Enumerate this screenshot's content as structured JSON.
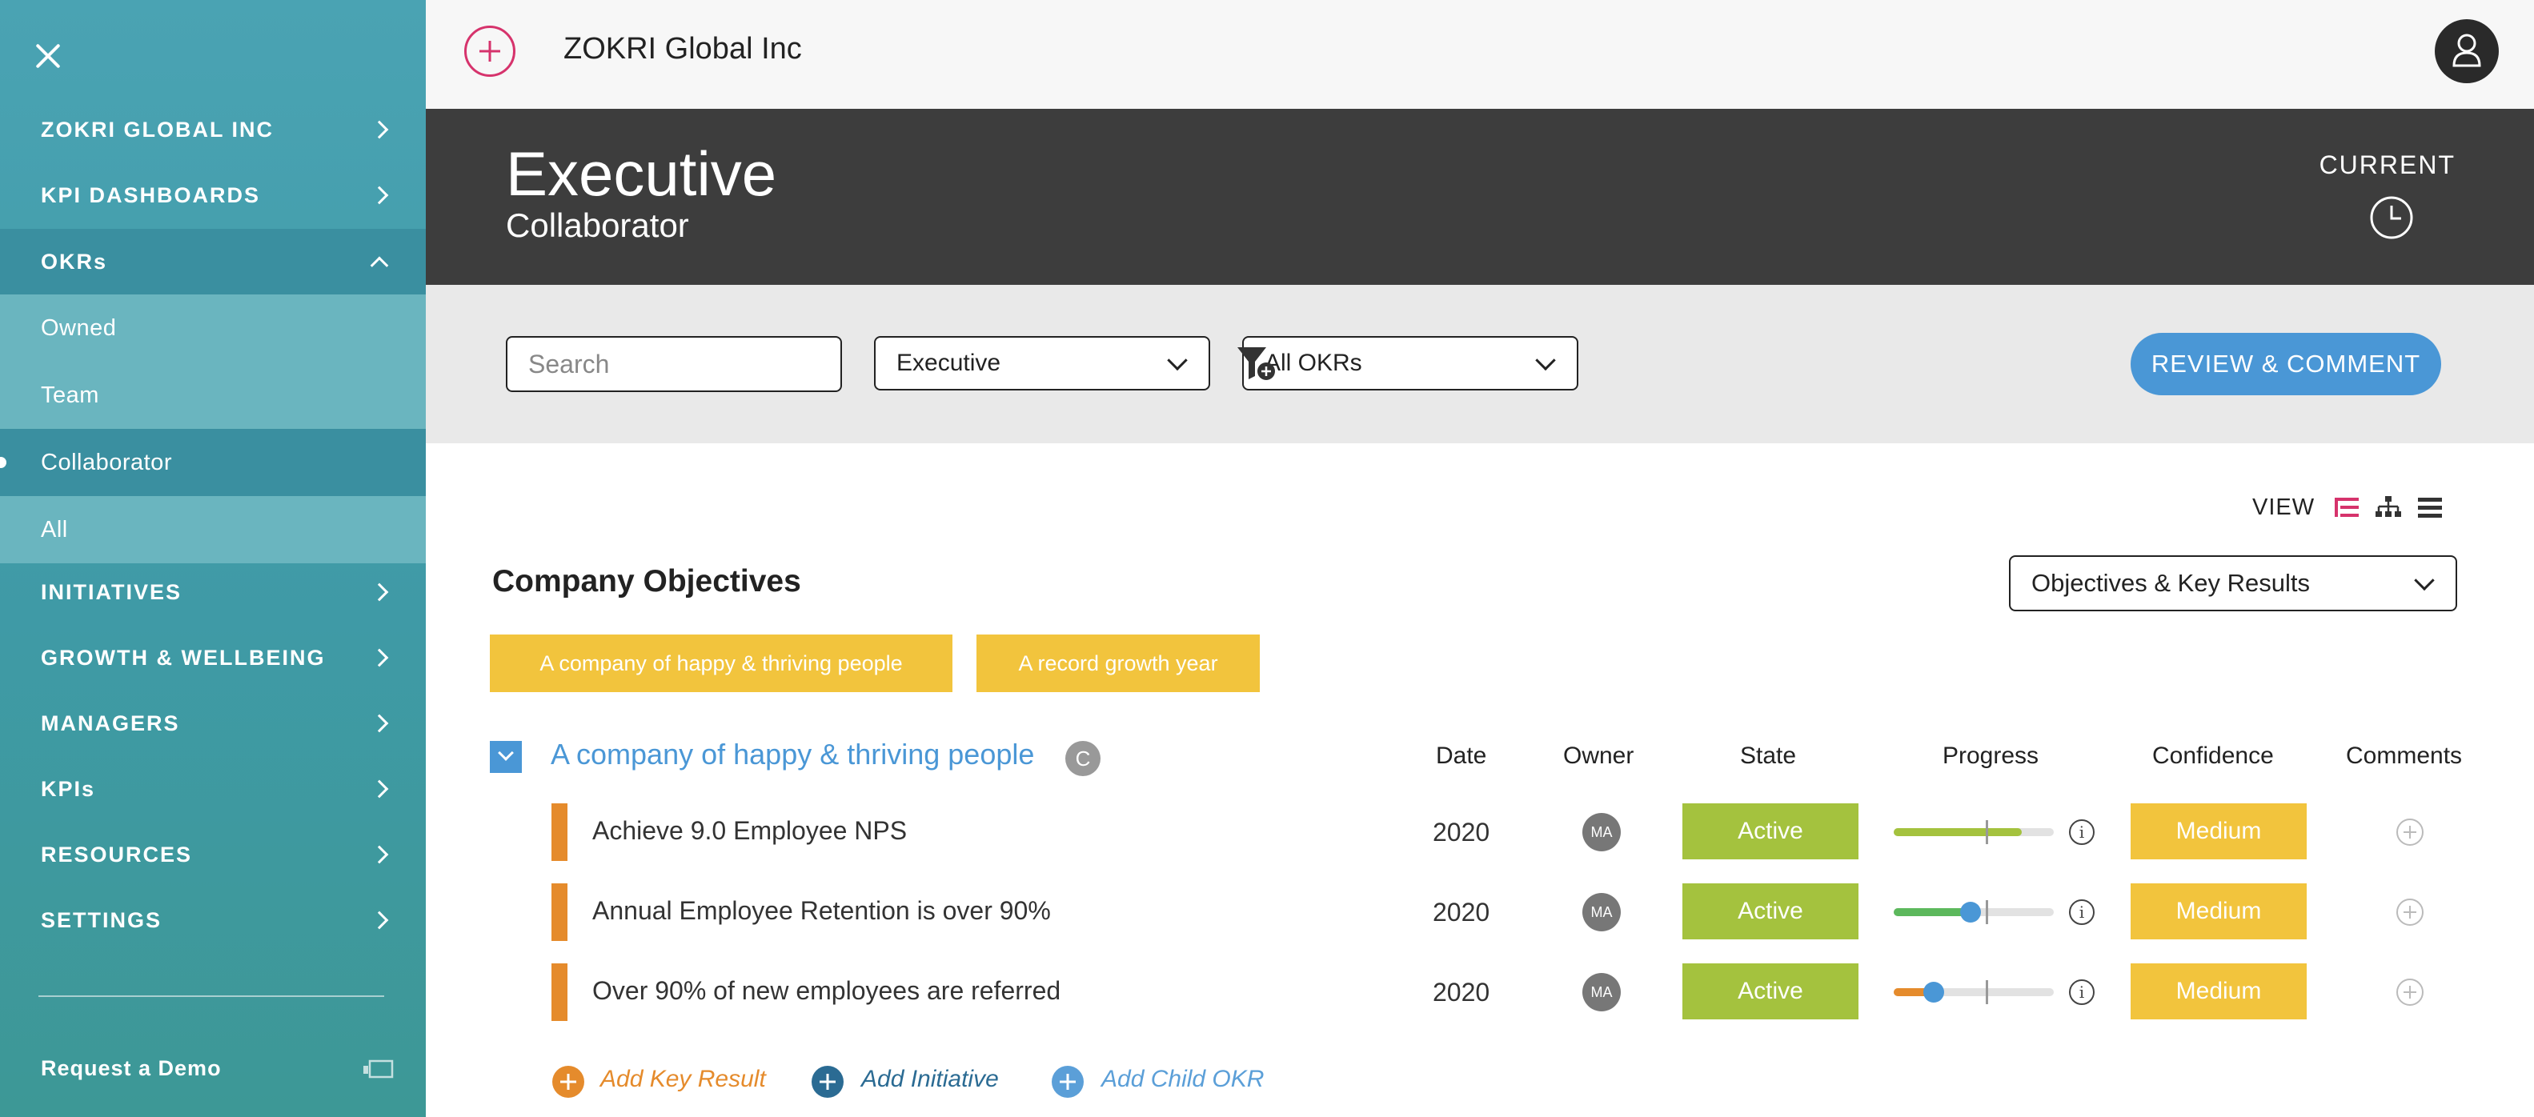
{
  "sidebar": {
    "items": [
      {
        "label": "ZOKRI GLOBAL INC"
      },
      {
        "label": "KPI DASHBOARDS"
      },
      {
        "label": "OKRs"
      },
      {
        "label": "INITIATIVES"
      },
      {
        "label": "GROWTH & WELLBEING"
      },
      {
        "label": "MANAGERS"
      },
      {
        "label": "KPIs"
      },
      {
        "label": "RESOURCES"
      },
      {
        "label": "SETTINGS"
      }
    ],
    "okr_sub_items": [
      {
        "label": "Owned"
      },
      {
        "label": "Team"
      },
      {
        "label": "Collaborator"
      },
      {
        "label": "All"
      }
    ],
    "request_demo": "Request a Demo"
  },
  "topbar": {
    "company_name": "ZOKRI Global Inc"
  },
  "header": {
    "title": "Executive",
    "subtitle": "Collaborator",
    "period": "CURRENT"
  },
  "filters": {
    "search_placeholder": "Search",
    "role_select": "Executive",
    "okr_select": "All OKRs",
    "review_button": "REVIEW & COMMENT"
  },
  "view": {
    "label": "VIEW",
    "dropdown": "Objectives & Key Results"
  },
  "company_objectives": {
    "title": "Company Objectives",
    "chips": [
      "A company of happy & thriving people",
      "A record growth year"
    ]
  },
  "objective": {
    "title": "A company of happy & thriving people",
    "badge": "C",
    "columns": {
      "date": "Date",
      "owner": "Owner",
      "state": "State",
      "progress": "Progress",
      "confidence": "Confidence",
      "comments": "Comments"
    },
    "key_results": [
      {
        "title": "Achieve 9.0 Employee NPS",
        "date": "2020",
        "owner": "MA",
        "state": "Active",
        "progress": 0.8,
        "confidence": "Medium"
      },
      {
        "title": "Annual Employee Retention is over 90%",
        "date": "2020",
        "owner": "MA",
        "state": "Active",
        "progress": 0.48,
        "confidence": "Medium"
      },
      {
        "title": "Over 90% of new employees are referred",
        "date": "2020",
        "owner": "MA",
        "state": "Active",
        "progress": 0.25,
        "confidence": "Medium"
      }
    ]
  },
  "actions": {
    "add_key_result": "Add Key Result",
    "add_initiative": "Add Initiative",
    "add_child_okr": "Add Child OKR"
  },
  "colors": {
    "sidebar": "#4aa3b3",
    "accent_blue": "#4a97d6",
    "active_green": "#a4c23e",
    "medium_yellow": "#f2c43d",
    "kr_orange": "#e58b2c",
    "brand_pink": "#d6336c"
  }
}
